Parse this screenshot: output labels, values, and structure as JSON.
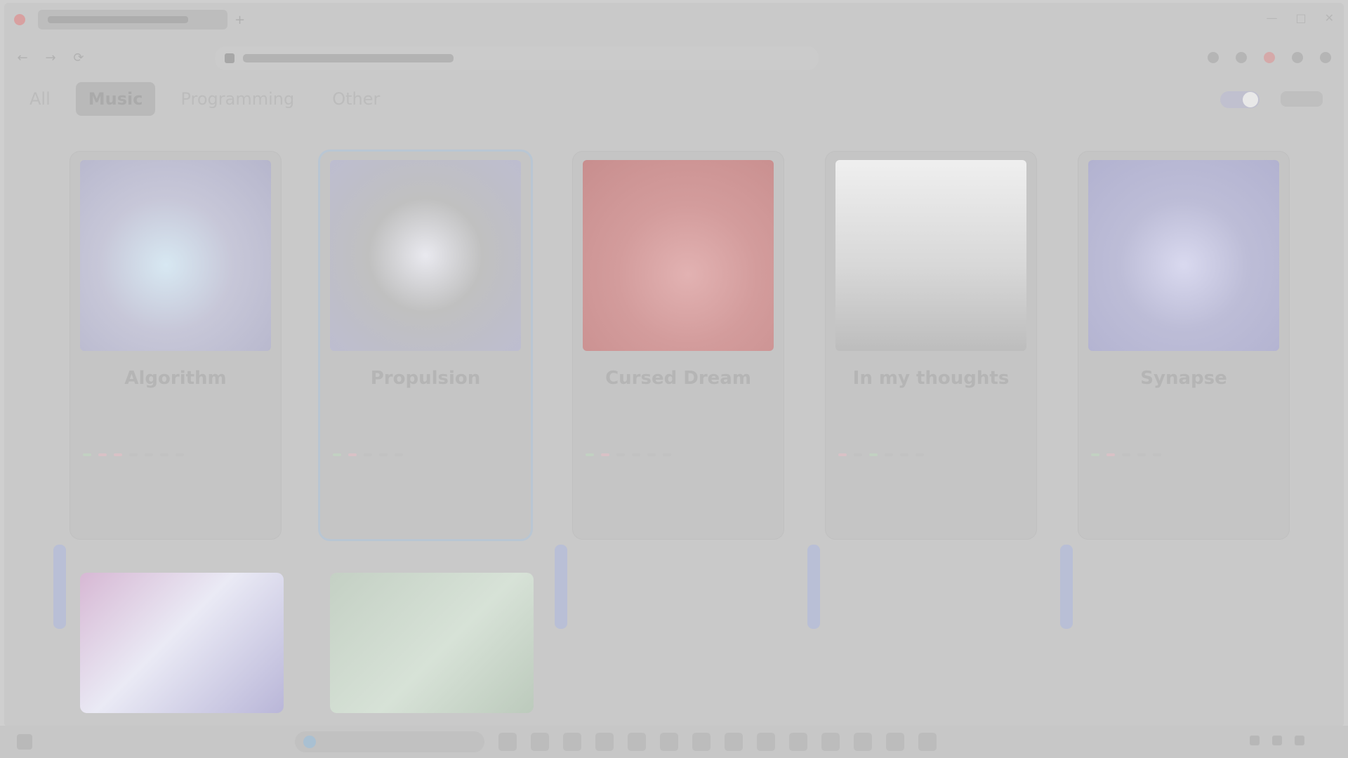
{
  "window": {
    "tab_title": "",
    "new_tab_symbol": "+",
    "controls": [
      "—",
      "□",
      "✕"
    ]
  },
  "navigation": {
    "back_symbol": "←",
    "forward_symbol": "→",
    "refresh_symbol": "⟳",
    "url": ""
  },
  "categories": [
    {
      "label": "All",
      "active": false
    },
    {
      "label": "Music",
      "active": true
    },
    {
      "label": "Programming",
      "active": false
    },
    {
      "label": "Other",
      "active": false
    }
  ],
  "cards": [
    {
      "title": "Algorithm",
      "description": "",
      "tags": [
        {
          "text": "",
          "color": "green"
        },
        {
          "text": "",
          "color": "pink"
        },
        {
          "text": "",
          "color": "pink"
        },
        {
          "text": "",
          "color": "gray"
        },
        {
          "text": "",
          "color": "gray"
        },
        {
          "text": "",
          "color": "gray"
        },
        {
          "text": "",
          "color": "gray"
        }
      ],
      "cover_colors": [
        "#c7c7d8",
        "#d7e8f2",
        "#b6b6cc"
      ]
    },
    {
      "title": "Propulsion",
      "description": "",
      "tags": [
        {
          "text": "",
          "color": "green"
        },
        {
          "text": "",
          "color": "pink"
        },
        {
          "text": "",
          "color": "gray"
        },
        {
          "text": "",
          "color": "gray"
        },
        {
          "text": "",
          "color": "gray"
        }
      ],
      "cover_colors": [
        "#c0c0c0",
        "#e9e9ef",
        "#bdbdd0"
      ]
    },
    {
      "title": "Cursed Dream",
      "description": "",
      "tags": [
        {
          "text": "",
          "color": "green"
        },
        {
          "text": "",
          "color": "pink"
        },
        {
          "text": "",
          "color": "gray"
        },
        {
          "text": "",
          "color": "gray"
        },
        {
          "text": "",
          "color": "gray"
        },
        {
          "text": "",
          "color": "gray"
        }
      ],
      "cover_colors": [
        "#d39c9c",
        "#e2b2b2",
        "#c88e8e"
      ]
    },
    {
      "title": "In my thoughts",
      "description": "",
      "tags": [
        {
          "text": "",
          "color": "pink"
        },
        {
          "text": "",
          "color": "gray"
        },
        {
          "text": "",
          "color": "green"
        },
        {
          "text": "",
          "color": "gray"
        },
        {
          "text": "",
          "color": "gray"
        },
        {
          "text": "",
          "color": "gray"
        }
      ],
      "cover_colors": [
        "#efefef",
        "#d8d8d8",
        "#bdbdbd"
      ]
    },
    {
      "title": "Synapse",
      "description": "",
      "tags": [
        {
          "text": "",
          "color": "green"
        },
        {
          "text": "",
          "color": "pink"
        },
        {
          "text": "",
          "color": "gray"
        },
        {
          "text": "",
          "color": "gray"
        },
        {
          "text": "",
          "color": "gray"
        }
      ],
      "cover_colors": [
        "#bdbdd7",
        "#d9d9ef",
        "#b2b2d0"
      ]
    }
  ],
  "second_row": [
    {
      "caption": "",
      "colors": [
        "#d7b8d4",
        "#eaeaf5",
        "#b9b6d8"
      ]
    },
    {
      "caption": "",
      "colors": [
        "#c4d0c4",
        "#d7e2d7",
        "#bccabc"
      ]
    }
  ],
  "taskbar": {
    "search_placeholder": "",
    "clock": "",
    "date": ""
  },
  "colors": {
    "accent": "#b9c6d3",
    "green_tag": "#c2d1c2",
    "pink_tag": "#d9c1c6"
  }
}
